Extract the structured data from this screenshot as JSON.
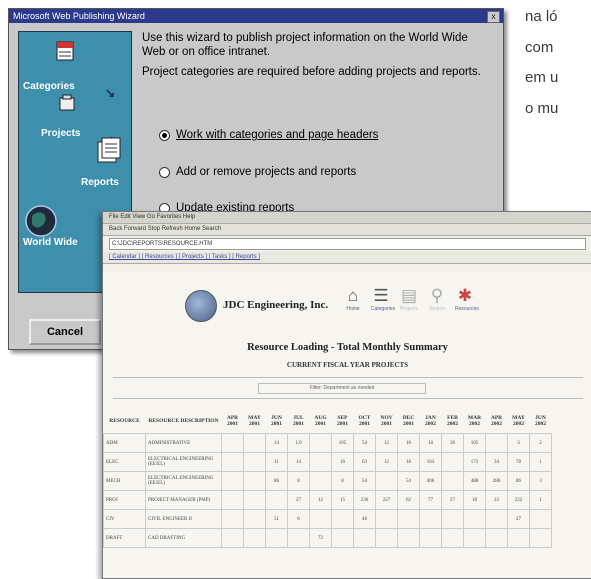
{
  "side_text": [
    "na ló",
    "com",
    "em u",
    "o mu"
  ],
  "wizard": {
    "title": "Microsoft Web Publishing Wizard",
    "close": "x",
    "sidebar": [
      "Categories",
      "Projects",
      "Reports",
      "World Wide"
    ],
    "desc1": "Use this wizard to publish project information on the World Wide Web or on office intranet.",
    "desc2": "Project categories are required before adding projects and reports.",
    "options": [
      {
        "label": "Work with categories and page headers",
        "checked": true
      },
      {
        "label": "Add or remove projects and reports",
        "checked": false
      },
      {
        "label": "Update existing reports",
        "checked": false
      }
    ],
    "cancel": "Cancel"
  },
  "browser": {
    "menu": "File  Edit  View  Go  Favorites  Help",
    "toolbar": "Back  Forward  Stop  Refresh  Home  Search",
    "address": "C:\\JDC\\REPORTS\\RESOURCE.HTM",
    "links": "[ Calendar ] [ Resources ] [ Projects ] [ Tasks ] [ Reports ]",
    "company": "JDC Engineering, Inc.",
    "nav": [
      {
        "icon": "home-icon",
        "glyph": "⌂",
        "label": "Home"
      },
      {
        "icon": "categories-icon",
        "glyph": "☰",
        "label": "Categories"
      },
      {
        "icon": "projects-icon",
        "glyph": "▤",
        "label": "Projects"
      },
      {
        "icon": "search-icon",
        "glyph": "⚲",
        "label": "Search"
      },
      {
        "icon": "resources-icon",
        "glyph": "✱",
        "label": "Resources"
      }
    ],
    "report_title": "Resource Loading - Total Monthly Summary",
    "report_sub": "CURRENT FISCAL YEAR PROJECTS",
    "filter": "Filter: Department as needed",
    "columns": [
      "RESOURCE",
      "RESOURCE DESCRIPTION",
      "APR 2001",
      "MAY 2001",
      "JUN 2001",
      "JUL 2001",
      "AUG 2001",
      "SEP 2001",
      "OCT 2001",
      "NOV 2001",
      "DEC 2001",
      "JAN 2002",
      "FEB 2002",
      "MAR 2002",
      "APR 2002",
      "MAY 2002",
      "JUN 2002"
    ],
    "rows": [
      [
        "ADM",
        "ADMINISTRATIVE",
        "",
        "",
        "14",
        "1.0",
        "",
        "105",
        "54",
        "12",
        "16",
        "18",
        "26",
        "105",
        "",
        "3",
        "2"
      ],
      [
        "ELEC",
        "ELECTRICAL ENGINEERING (EE/EL)",
        "",
        "",
        "11",
        "14",
        "",
        "16",
        "63",
        "12",
        "16",
        "103",
        "",
        "173",
        "34",
        "78",
        "1"
      ],
      [
        "MECH",
        "ELECTRICAL ENGINEERING (EE/EL)",
        "",
        "",
        "86",
        "8",
        "",
        "8",
        "54",
        "",
        "54",
        "406",
        "",
        "488",
        "286",
        "86",
        "3"
      ],
      [
        "PROJ",
        "PROJECT MANAGER (PMP)",
        "",
        "",
        "",
        "27",
        "12",
        "15",
        "236",
        "227",
        "62",
        "77",
        "27",
        "18",
        "22",
        "222",
        "1"
      ],
      [
        "CIV",
        "CIVIL ENGINEER II",
        "",
        "",
        "51",
        "6",
        "",
        "",
        "46",
        "",
        "",
        "",
        "",
        "",
        "",
        "27",
        ""
      ],
      [
        "DRAFT",
        "CAD DRAFTING",
        "",
        "",
        "",
        "",
        "72",
        "",
        "",
        "",
        "",
        "",
        "",
        "",
        "",
        "",
        ""
      ]
    ]
  }
}
